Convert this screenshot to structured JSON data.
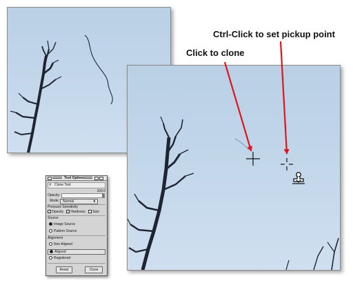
{
  "annotations": {
    "pickup": "Ctrl-Click to set pickup point",
    "clone": "Click to clone"
  },
  "icons": {
    "crosshair": "crosshair-cursor-icon",
    "pickup": "pickup-point-target-icon",
    "clone_stamp": "clone-stamp-cursor-icon"
  },
  "tool_options": {
    "title": "Tool Options",
    "tool_name": "Clone Tool",
    "opacity_label": "Opacity:",
    "opacity_value": "100.0",
    "mode_label": "Mode:",
    "mode_value": "Normal",
    "pressure_label": "Pressure Sensitivity",
    "pressure_opacity": "Opacity",
    "pressure_hardness": "Hardness",
    "pressure_size": "Size",
    "source_label": "Source",
    "source_image": "Image Source",
    "source_pattern": "Pattern Source",
    "alignment_label": "Alignment",
    "align_non": "Non Aligned",
    "align_aligned": "Aligned",
    "align_registered": "Registered",
    "reset_label": "Reset",
    "close_label": "Close"
  },
  "colors": {
    "arrow": "#e0141c",
    "sky": "#c2d6ea",
    "branch": "#1e2530"
  }
}
